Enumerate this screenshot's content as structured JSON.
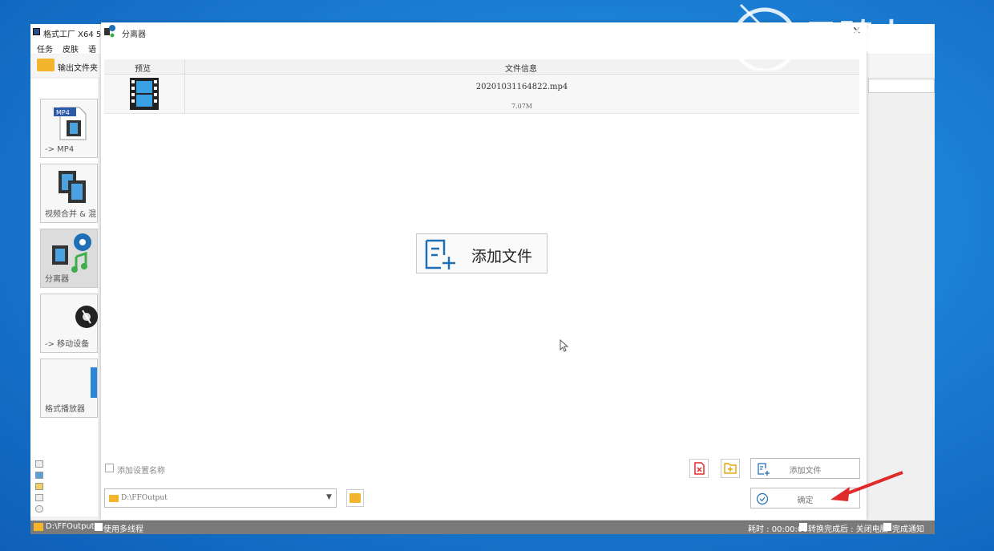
{
  "app": {
    "title": "格式工厂 X64 5",
    "menu": [
      "任务",
      "皮肤",
      "语"
    ],
    "toolbar_output_folder": "输出文件夹",
    "sidebar_tiles": [
      {
        "label": "-> MP4",
        "icon": "mp4-file-icon"
      },
      {
        "label": "视频合并 & 混",
        "icon": "video-merge-icon"
      },
      {
        "label": "分离器",
        "icon": "splitter-icon",
        "active": true
      },
      {
        "label": "-> 移动设备",
        "icon": "mobile-device-icon"
      },
      {
        "label": "格式播放器",
        "icon": "player-icon"
      }
    ],
    "status_path": "D:\\FFOutput",
    "status_multithread": "使用多线程",
    "status_elapsed": "耗时 : 00:00:00",
    "status_after_done": "转换完成后 : 关闭电脑",
    "status_notify": "完成通知"
  },
  "dialog": {
    "title": "分离器",
    "columns": [
      "预览",
      "文件信息"
    ],
    "file": {
      "name": "20201031164822.mp4",
      "size": "7.07M"
    },
    "add_file_big": "添加文件",
    "checkbox_label": "添加设置名称",
    "output_path": "D:\\FFOutput",
    "add_file_button": "添加文件",
    "ok_button": "确定"
  },
  "watermark": {
    "text": "云骑士"
  },
  "colors": {
    "accent_red": "#e02b2b",
    "folder_yellow": "#f3b52d",
    "icon_blue": "#1e6fb6"
  }
}
